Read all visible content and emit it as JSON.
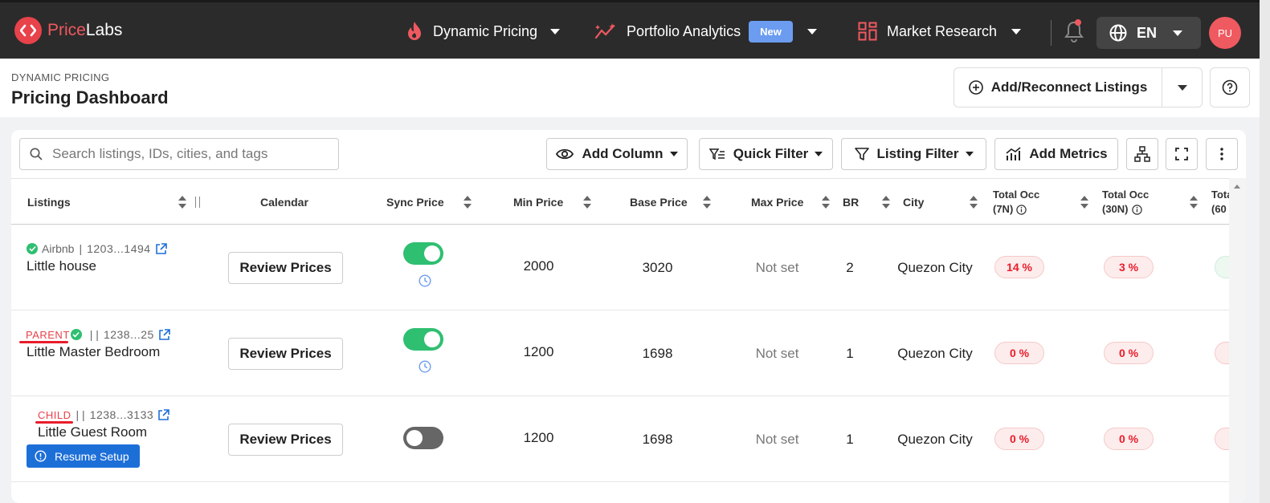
{
  "app": {
    "brand_part1": "Price",
    "brand_part2": "Labs",
    "accent": "#e8424b"
  },
  "topnav": {
    "dynamic_pricing": "Dynamic Pricing",
    "portfolio_analytics": "Portfolio Analytics",
    "new_badge": "New",
    "market_research": "Market Research",
    "language": "EN",
    "avatar_initials": "PU"
  },
  "header": {
    "breadcrumb": "DYNAMIC PRICING",
    "title": "Pricing Dashboard",
    "add_button": "Add/Reconnect Listings"
  },
  "toolbar": {
    "search_placeholder": "Search listings, IDs, cities, and tags",
    "add_column": "Add Column",
    "quick_filter": "Quick Filter",
    "listing_filter": "Listing Filter",
    "add_metrics": "Add Metrics"
  },
  "columns": {
    "listings": "Listings",
    "calendar": "Calendar",
    "sync_price": "Sync Price",
    "min_price": "Min Price",
    "base_price": "Base Price",
    "max_price": "Max Price",
    "br": "BR",
    "city": "City",
    "total_occ_7_a": "Total Occ",
    "total_occ_7_b": "(7N)",
    "total_occ_30_a": "Total Occ",
    "total_occ_30_b": "(30N)",
    "total_occ_60_a": "Tota",
    "total_occ_60_b": "(60"
  },
  "rows": [
    {
      "source": "Airbnb",
      "sep": "|",
      "id": "1203...1494",
      "name": "Little house",
      "review": "Review Prices",
      "sync_on": true,
      "min": "2000",
      "base": "3020",
      "max": "Not set",
      "br": "2",
      "city": "Quezon City",
      "occ7": "14 %",
      "occ30": "3 %"
    },
    {
      "tag": "PARENT",
      "sep": "|  |",
      "id": "1238...25",
      "name": "Little Master Bedroom",
      "review": "Review Prices",
      "sync_on": true,
      "min": "1200",
      "base": "1698",
      "max": "Not set",
      "br": "1",
      "city": "Quezon City",
      "occ7": "0 %",
      "occ30": "0 %"
    },
    {
      "tag": "CHILD",
      "sep": "|  |",
      "id": "1238...3133",
      "name": "Little Guest Room",
      "resume": "Resume Setup",
      "review": "Review Prices",
      "sync_on": false,
      "min": "1200",
      "base": "1698",
      "max": "Not set",
      "br": "1",
      "city": "Quezon City",
      "occ7": "0 %",
      "occ30": "0 %"
    }
  ]
}
